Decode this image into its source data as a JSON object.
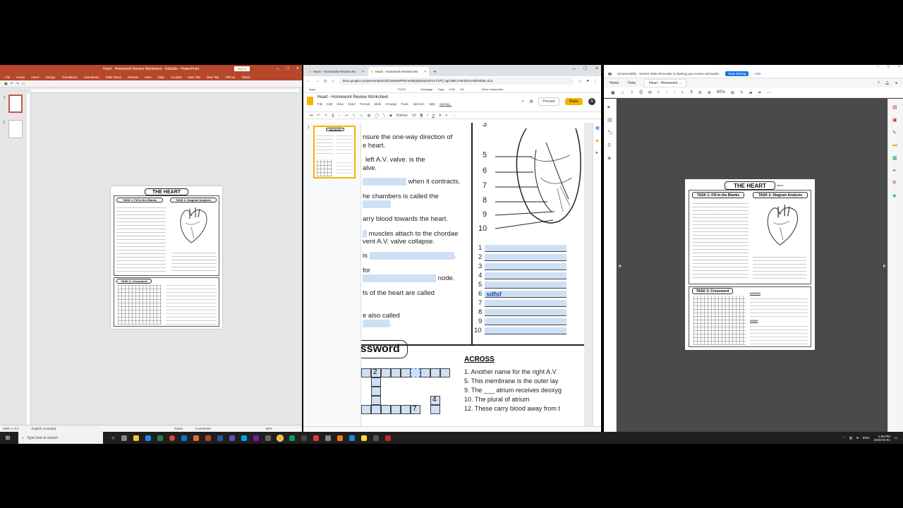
{
  "powerpoint": {
    "window_title": "Heart - Homework Review Worksheet - Editable - PowerPoint",
    "sign_in": "Sign in",
    "ribbon_tabs": [
      "File",
      "Home",
      "Insert",
      "Design",
      "Transitions",
      "Animations",
      "Slide Show",
      "Review",
      "View",
      "Help",
      "Acrobat",
      "New Tab",
      "New Tab",
      "Tell me",
      "Share"
    ],
    "slide_numbers": [
      "1",
      "2"
    ],
    "status": {
      "slide": "Slide 1 of 2",
      "language": "English (Canada)",
      "notes": "Notes",
      "comments": "Comments",
      "zoom": "60%"
    }
  },
  "chrome": {
    "tabs": [
      {
        "label": "Heart - Homework Review Wo"
      },
      {
        "label": "Heart - Homework Review Wo"
      }
    ],
    "url": "docs.google.com/presentation/d/1Z6xkMFRGnH4BQ6j3OpO8TCxT1Pfl_0gCNBCx76c0hnA/edit#slide=id.p",
    "bookmarks": [
      "Apps",
      "PCHC",
      "Mortgage",
      "Yoga",
      "CAN",
      "US",
      "Other bookmarks"
    ],
    "slides": {
      "doc_title": "Heart - Homework Review Worksheet",
      "menu": [
        "File",
        "Edit",
        "View",
        "Insert",
        "Format",
        "Slide",
        "Arrange",
        "Tools",
        "Add-ons",
        "Help",
        "Saving..."
      ],
      "present": "Present",
      "share": "Share",
      "avatar": "A",
      "font": "Roboto",
      "font_size": "10",
      "lines": [
        "nsure the one-way direction of",
        "e heart.",
        "left A.V. valve. is the",
        "alve.",
        "when it contracts.",
        "he chambers is called the",
        "arry blood towards the heart.",
        "muscles attach to the chordae",
        "vent A.V. valve collapse.",
        "is",
        "for",
        "node.",
        "ts of the heart are called",
        "e also called",
        "."
      ],
      "diagram_labels": [
        "3",
        "5",
        "6",
        "7",
        "8",
        "9",
        "10"
      ],
      "answer_numbers": [
        "1",
        "2",
        "3",
        "4",
        "5",
        "6",
        "7",
        "8",
        "9",
        "10"
      ],
      "answer_5": "sdfsf",
      "crossword_title": "ossword",
      "crossword_numbers": [
        "2",
        "7",
        "4"
      ],
      "across_heading": "ACROSS",
      "across": [
        "1.  Another name for the right A.V",
        "5.  This membrane is the outer lay",
        "9.  The ___ atrium receives deoxyg",
        "10.  The plural of atrium",
        "12.  These carry blood away from t"
      ]
    }
  },
  "acrobat": {
    "share_notice": "Screencastify - Screen Video Recorder is sharing your screen and audio.",
    "stop_sharing": "Stop sharing",
    "hide": "Hide",
    "tabs": [
      "Home",
      "Tools",
      "Heart - Homework ..."
    ],
    "zoom": "60%"
  },
  "worksheet": {
    "title": "THE HEART",
    "name_label": "Name:",
    "task1": "TASK 1: Fill In the Blanks",
    "task2": "TASK 2: Diagram Analysis",
    "task3": "TASK 3: Crossword",
    "across": "ACROSS",
    "down": "DOWN"
  },
  "taskbar": {
    "search_placeholder": "Type here to search",
    "language": "ENG",
    "time": "1:58 PM",
    "date": "2020-04-01"
  },
  "colors": {
    "ppt_accent": "#b7472a",
    "slides_accent": "#f4b400",
    "blank_fill": "#cfe0f5",
    "acrobat_bg": "#4a4a4a"
  }
}
